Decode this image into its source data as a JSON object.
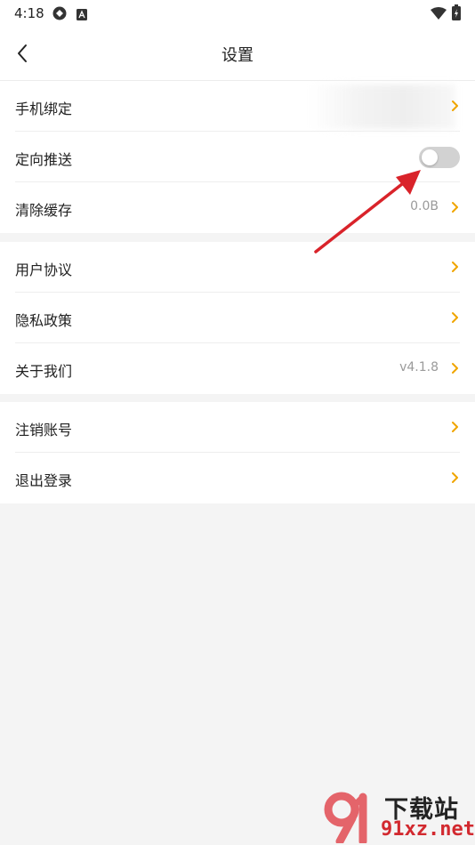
{
  "status_bar": {
    "time": "4:18"
  },
  "header": {
    "title": "设置"
  },
  "groups": [
    {
      "items": [
        {
          "label": "手机绑定"
        },
        {
          "label": "定向推送",
          "toggle_on": false
        },
        {
          "label": "清除缓存",
          "value": "0.0B"
        }
      ]
    },
    {
      "items": [
        {
          "label": "用户协议"
        },
        {
          "label": "隐私政策"
        },
        {
          "label": "关于我们",
          "value": "v4.1.8"
        }
      ]
    },
    {
      "items": [
        {
          "label": "注销账号"
        },
        {
          "label": "退出登录"
        }
      ]
    }
  ],
  "watermark": {
    "brand_cn": "下载站",
    "brand_en": "91xz.net"
  },
  "colors": {
    "accent": "#f0a500",
    "toggle_off": "#d2d2d2",
    "annotation_arrow": "#d9232a"
  }
}
